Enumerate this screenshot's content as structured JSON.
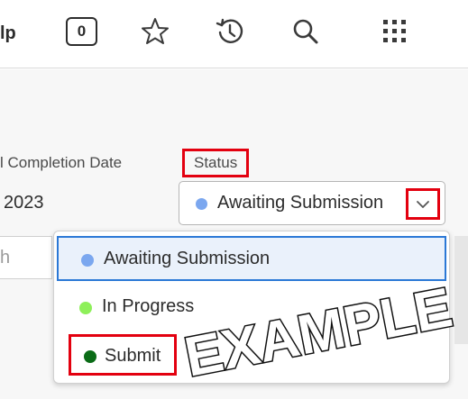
{
  "toolbar": {
    "help_partial": "lp",
    "notification_count": "0",
    "icons": [
      "star-icon",
      "history-icon",
      "search-icon",
      "app-grid-icon"
    ]
  },
  "form": {
    "date_column_label": "l Completion Date",
    "date_value": "2023",
    "status_label": "Status",
    "status_value": "Awaiting Submission",
    "status_color": "#7ba7ef",
    "search_partial": "h"
  },
  "dropdown": {
    "options": [
      {
        "label": "Awaiting Submission",
        "color": "#7ba7ef"
      },
      {
        "label": "In Progress",
        "color": "#8ef05a"
      },
      {
        "label": "Submit",
        "color": "#0a6b16"
      }
    ]
  },
  "watermark": {
    "text": "EXAMPLE"
  },
  "colors": {
    "highlight": "#e3000f",
    "selected_border": "#2b78d6"
  }
}
